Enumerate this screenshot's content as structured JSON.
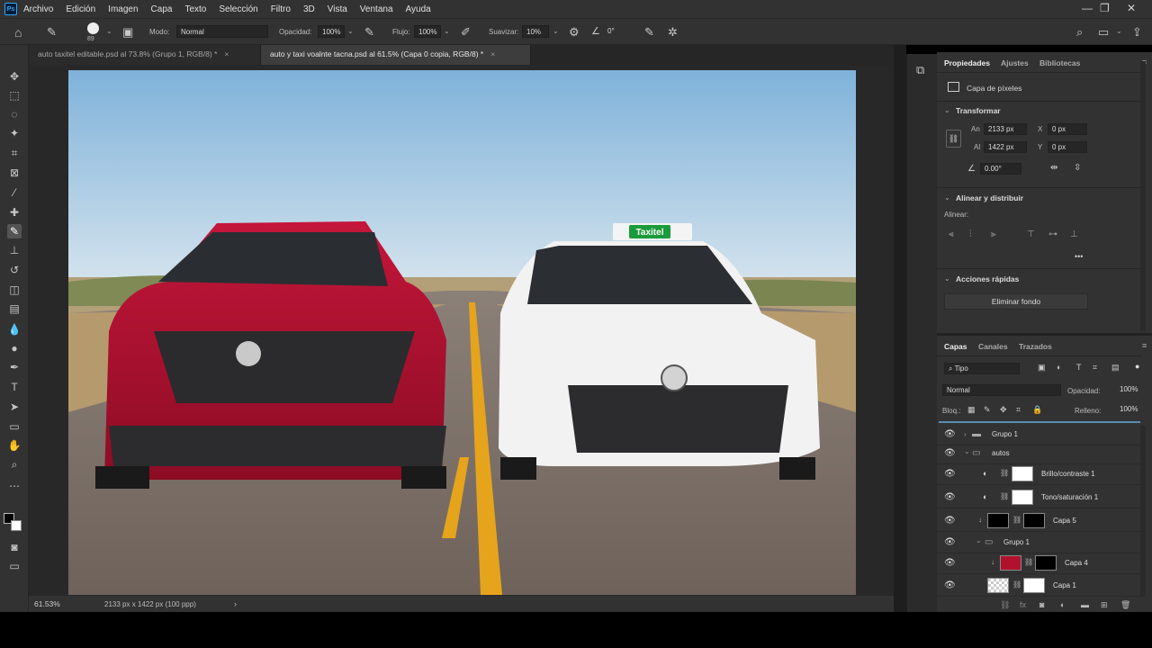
{
  "app": {
    "logo": "Ps"
  },
  "menu": [
    "Archivo",
    "Edición",
    "Imagen",
    "Capa",
    "Texto",
    "Selección",
    "Filtro",
    "3D",
    "Vista",
    "Ventana",
    "Ayuda"
  ],
  "options": {
    "brush_size": "89",
    "mode_label": "Modo:",
    "mode_value": "Normal",
    "opacity_label": "Opacidad:",
    "opacity_value": "100%",
    "flow_label": "Flujo:",
    "flow_value": "100%",
    "smooth_label": "Suavizar:",
    "smooth_value": "10%",
    "angle_value": "0°"
  },
  "tabs": [
    {
      "label": "auto taxitel editable.psd al 73.8% (Grupo 1, RGB/8) *",
      "close": "×"
    },
    {
      "label": "auto y taxi voalnte tacna.psd al 61.5% (Capa 0 copia, RGB/8) *",
      "close": "×"
    }
  ],
  "image": {
    "taxi_sign": "Taxitel"
  },
  "status": {
    "zoom": "61.53%",
    "doc_info": "2133 px x 1422 px (100 ppp)",
    "arrow": "›"
  },
  "properties": {
    "tabs": [
      "Propiedades",
      "Ajustes",
      "Bibliotecas"
    ],
    "layer_type": "Capa de píxeles",
    "transform_title": "Transformar",
    "w_label": "An",
    "w_value": "2133 px",
    "h_label": "Al",
    "h_value": "1422 px",
    "x_label": "X",
    "x_value": "0 px",
    "y_label": "Y",
    "y_value": "0 px",
    "angle_value": "0.00°",
    "align_title": "Alinear y distribuir",
    "align_label": "Alinear:",
    "more": "•••",
    "quick_title": "Acciones rápidas",
    "remove_bg": "Eliminar fondo"
  },
  "layers_panel": {
    "tabs": [
      "Capas",
      "Canales",
      "Trazados"
    ],
    "filter": "Tipo",
    "blend": "Normal",
    "opacity_label": "Opacidad:",
    "opacity_value": "100%",
    "lock_label": "Bloq.:",
    "fill_label": "Relleno:",
    "fill_value": "100%",
    "rows": [
      {
        "name": "Grupo 1"
      },
      {
        "name": "autos"
      },
      {
        "name": "Brillo/contraste 1"
      },
      {
        "name": "Tono/saturación 1"
      },
      {
        "name": "Capa 5"
      },
      {
        "name": "Grupo 1"
      },
      {
        "name": "Capa 4"
      },
      {
        "name": "Capa 1"
      }
    ]
  },
  "colors": {
    "accent": "#31a8ff",
    "car_red": "#b0122e",
    "taxi_green": "#1a9b3c"
  }
}
